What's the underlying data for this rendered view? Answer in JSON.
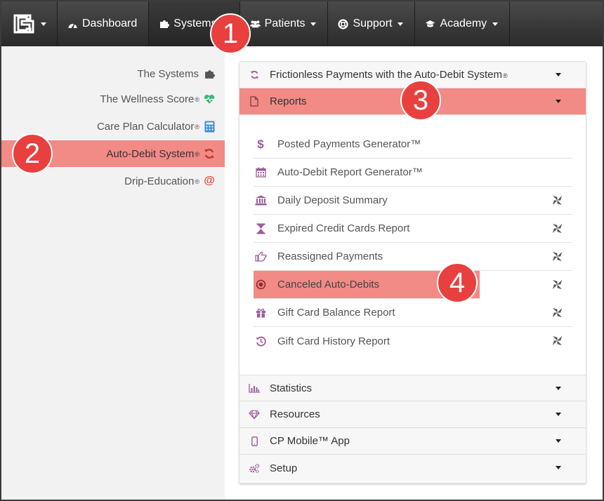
{
  "nav": {
    "items": [
      {
        "label": "Dashboard",
        "icon": "dashboard-icon"
      },
      {
        "label": "Systems",
        "icon": "puzzle-icon"
      },
      {
        "label": "Patients",
        "icon": "users-icon"
      },
      {
        "label": "Support",
        "icon": "lifebuoy-icon"
      },
      {
        "label": "Academy",
        "icon": "graduation-cap-icon"
      }
    ]
  },
  "sidebar": {
    "items": [
      {
        "label": "The Systems",
        "reg": "",
        "icon": "puzzle-icon"
      },
      {
        "label": "The Wellness Score",
        "reg": "®",
        "icon": "heartbeat-icon"
      },
      {
        "label": "Care Plan Calculator",
        "reg": "®",
        "icon": "calculator-icon"
      },
      {
        "label": "Auto-Debit System",
        "reg": "®",
        "icon": "refresh-icon"
      },
      {
        "label": "Drip-Education",
        "reg": "®",
        "icon": "at-icon"
      }
    ]
  },
  "accordion": {
    "top": [
      {
        "label": "Frictionless Payments with the Auto-Debit System",
        "reg": "®",
        "icon": "refresh-icon"
      },
      {
        "label": "Reports",
        "reg": "",
        "icon": "file-icon"
      }
    ],
    "bottom": [
      {
        "label": "Statistics",
        "icon": "bar-chart-icon"
      },
      {
        "label": "Resources",
        "icon": "diamond-icon"
      },
      {
        "label": "CP Mobile™ App",
        "icon": "mobile-icon"
      },
      {
        "label": "Setup",
        "icon": "cogs-icon"
      }
    ]
  },
  "reports": [
    {
      "label": "Posted Payments Generator™",
      "icon": "dollar-icon",
      "pinned": false
    },
    {
      "label": "Auto-Debit Report Generator™",
      "icon": "calendar-icon",
      "pinned": false
    },
    {
      "label": "Daily Deposit Summary",
      "icon": "bank-icon",
      "pinned": true
    },
    {
      "label": "Expired Credit Cards Report",
      "icon": "hourglass-icon",
      "pinned": true
    },
    {
      "label": "Reassigned Payments",
      "icon": "hand-point-icon",
      "pinned": true
    },
    {
      "label": "Canceled Auto-Debits",
      "icon": "dot-circle-icon",
      "pinned": true
    },
    {
      "label": "Gift Card Balance Report",
      "icon": "gift-icon",
      "pinned": true
    },
    {
      "label": "Gift Card History Report",
      "icon": "history-icon",
      "pinned": true
    }
  ],
  "badges": [
    "1",
    "2",
    "3",
    "4"
  ],
  "colors": {
    "highlight": "#f28a86",
    "badge": "#e8403f",
    "accent": "#9b5b9b",
    "nav": "#333333"
  }
}
